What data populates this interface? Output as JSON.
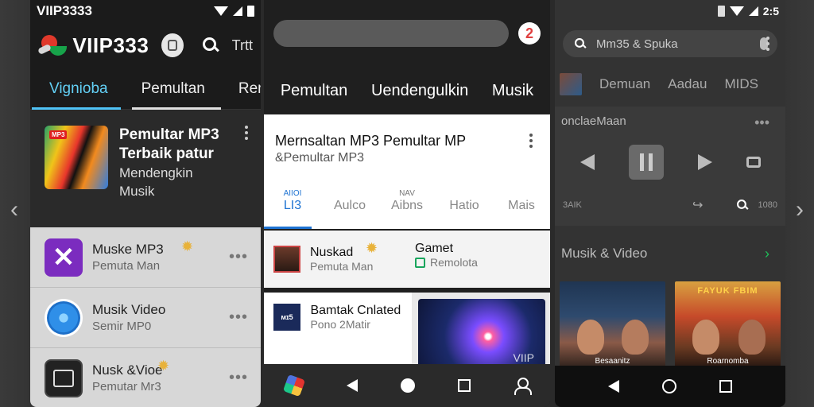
{
  "screen_left_arrow": "‹",
  "screen_right_arrow": "›",
  "phone1": {
    "status": {
      "carrier": "VIIP3333"
    },
    "header": {
      "title": "VIIP333",
      "trunc_text": "Trtt"
    },
    "tabs": [
      {
        "label": "Vignioba"
      },
      {
        "label": "Pemultan"
      },
      {
        "label": "Remu"
      }
    ],
    "feature": {
      "badge": "MP3",
      "title_line1": "Pemultar MP3",
      "title_line2": "Terbaik patur",
      "sub_line1": "Mendengkin",
      "sub_line2": "Musik"
    },
    "rows": [
      {
        "title": "Muske MP3",
        "subtitle": "Pemuta Man",
        "menu": "•••"
      },
      {
        "title": "Musik Video",
        "subtitle": "Semir MP0",
        "menu": "•••"
      },
      {
        "title": "Nusk &Vioe",
        "subtitle": "Pemutar Mr3",
        "menu": "•••"
      }
    ]
  },
  "phone2": {
    "avatar": "2",
    "tabs": [
      {
        "label": "Pemultan"
      },
      {
        "label": "Uendengulkin"
      },
      {
        "label": "Musik"
      }
    ],
    "card": {
      "title": "Mernsaltan MP3 Pemultar MP",
      "subtitle": "&Pemultar MP3",
      "subtabs": [
        {
          "small": "AIIOI",
          "label": "LI3"
        },
        {
          "small": "",
          "label": "Aulco"
        },
        {
          "small": "NAV",
          "label": "Aibns"
        },
        {
          "small": "",
          "label": "Hatio"
        },
        {
          "small": "",
          "label": "Mais"
        }
      ]
    },
    "row": {
      "title": "Nuskad",
      "subtitle": "Pemuta Man",
      "col2_title": "Gamet",
      "col2_subtitle": "Remolota"
    },
    "grid": {
      "icon_text": "ᴍɪ5",
      "title": "Bamtak Cnlated",
      "subtitle": "Pono 2Matir",
      "art_text": "VIIP"
    }
  },
  "phone3": {
    "status": {
      "time": "2:5"
    },
    "search": {
      "placeholder": "Mm35 & Spuka"
    },
    "tabs": [
      {
        "label": "Demuan"
      },
      {
        "label": "Aadau"
      },
      {
        "label": "MIDS"
      }
    ],
    "player": {
      "title": "onclaeMaan",
      "menu": "•••",
      "left_label": "3AIK",
      "right_label": "1080"
    },
    "section": {
      "title": "Musik & Video"
    },
    "posters": [
      {
        "header": "",
        "caption": "Besaanitz"
      },
      {
        "header": "FAYUK FBIM",
        "caption": "Roarnomba"
      }
    ]
  }
}
